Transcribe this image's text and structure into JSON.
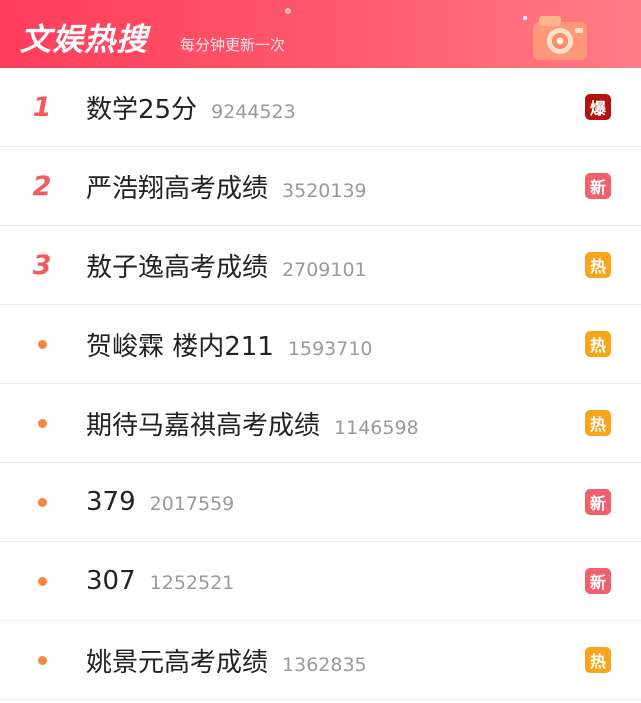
{
  "header": {
    "title": "文娱热搜",
    "subtitle": "每分钟更新一次"
  },
  "colors": {
    "header_gradient_start": "#ff3d5c",
    "header_gradient_end": "#ff7d86",
    "rank_top": "#f25b5b",
    "dot": "#f5883a",
    "badge_bao": "#b3120e",
    "badge_xin": "#f2606e",
    "badge_re": "#f8a51c"
  },
  "items": [
    {
      "rank": "1",
      "topic": "数学25分",
      "count": "9244523",
      "badge": "爆",
      "badge_type": "bao"
    },
    {
      "rank": "2",
      "topic": "严浩翔高考成绩",
      "count": "3520139",
      "badge": "新",
      "badge_type": "xin"
    },
    {
      "rank": "3",
      "topic": "敖子逸高考成绩",
      "count": "2709101",
      "badge": "热",
      "badge_type": "re"
    },
    {
      "rank": "",
      "topic": "贺峻霖 楼内211",
      "count": "1593710",
      "badge": "热",
      "badge_type": "re"
    },
    {
      "rank": "",
      "topic": "期待马嘉祺高考成绩",
      "count": "1146598",
      "badge": "热",
      "badge_type": "re"
    },
    {
      "rank": "",
      "topic": "379",
      "count": "2017559",
      "badge": "新",
      "badge_type": "xin"
    },
    {
      "rank": "",
      "topic": "307",
      "count": "1252521",
      "badge": "新",
      "badge_type": "xin"
    },
    {
      "rank": "",
      "topic": "姚景元高考成绩",
      "count": "1362835",
      "badge": "热",
      "badge_type": "re"
    }
  ]
}
